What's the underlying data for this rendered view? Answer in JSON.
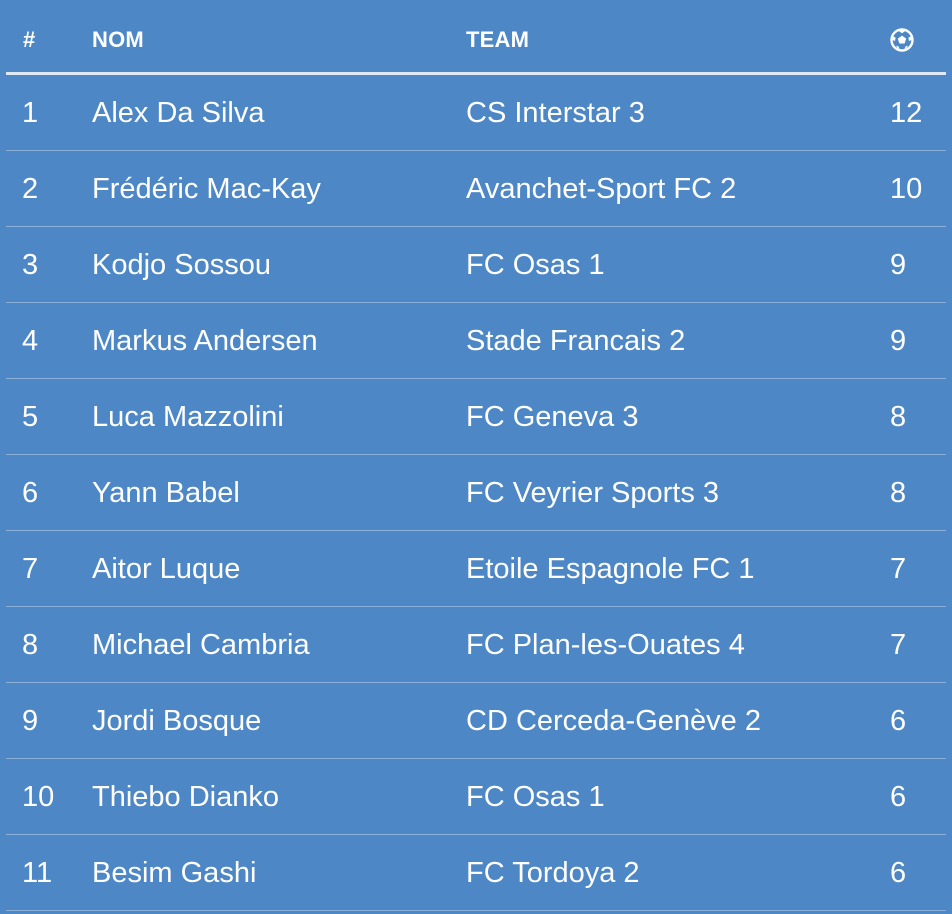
{
  "table": {
    "headers": {
      "rank": "#",
      "name": "NOM",
      "team": "TEAM",
      "goals_icon": "soccer-ball-icon"
    },
    "rows": [
      {
        "rank": "1",
        "name": "Alex Da Silva",
        "team": "CS Interstar 3",
        "goals": "12"
      },
      {
        "rank": "2",
        "name": "Frédéric Mac-Kay",
        "team": "Avanchet-Sport FC 2",
        "goals": "10"
      },
      {
        "rank": "3",
        "name": "Kodjo Sossou",
        "team": "FC Osas 1",
        "goals": "9"
      },
      {
        "rank": "4",
        "name": "Markus Andersen",
        "team": "Stade Francais 2",
        "goals": "9"
      },
      {
        "rank": "5",
        "name": "Luca Mazzolini",
        "team": "FC Geneva 3",
        "goals": "8"
      },
      {
        "rank": "6",
        "name": "Yann Babel",
        "team": "FC Veyrier Sports 3",
        "goals": "8"
      },
      {
        "rank": "7",
        "name": "Aitor Luque",
        "team": "Etoile Espagnole FC 1",
        "goals": "7"
      },
      {
        "rank": "8",
        "name": "Michael Cambria",
        "team": "FC Plan-les-Ouates 4",
        "goals": "7"
      },
      {
        "rank": "9",
        "name": "Jordi Bosque",
        "team": "CD Cerceda-Genève 2",
        "goals": "6"
      },
      {
        "rank": "10",
        "name": "Thiebo Dianko",
        "team": "FC Osas 1",
        "goals": "6"
      },
      {
        "rank": "11",
        "name": "Besim Gashi",
        "team": "FC Tordoya 2",
        "goals": "6"
      }
    ]
  },
  "colors": {
    "background": "#4d87c6",
    "header_rule": "#dfe8f4",
    "row_divider": "#8ab0da",
    "text": "#ffffff"
  }
}
